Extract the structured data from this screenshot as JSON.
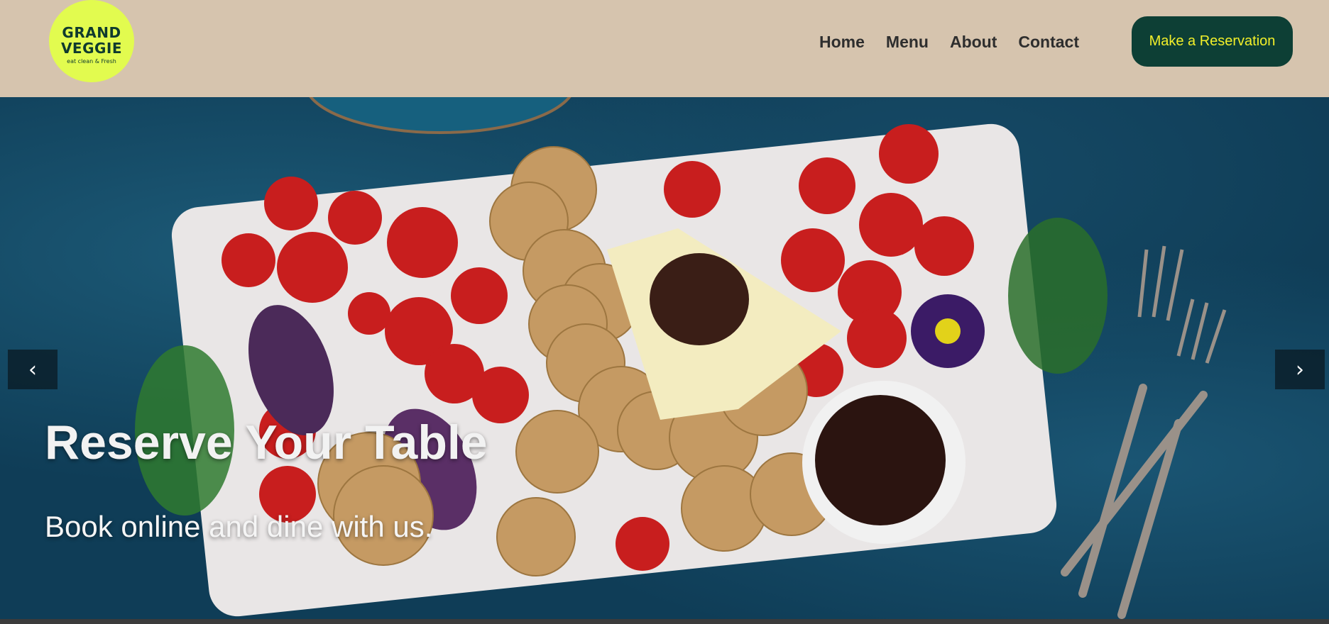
{
  "logo": {
    "line1": "GRAND",
    "line2": "VEGGIE",
    "tagline": "eat clean & Fresh"
  },
  "nav": {
    "items": [
      "Home",
      "Menu",
      "About",
      "Contact"
    ]
  },
  "cta": {
    "label": "Make a Reservation"
  },
  "hero": {
    "title": "Reserve Your Table",
    "subtitle": "Book online and dine with us.",
    "prev_label": "‹",
    "next_label": "›"
  },
  "colors": {
    "header_bg": "#d6c4ae",
    "logo_bg": "#e2fb4f",
    "cta_bg": "#0d3f35",
    "cta_text": "#f2ef2a",
    "hero_bg": "#0f3d57"
  }
}
